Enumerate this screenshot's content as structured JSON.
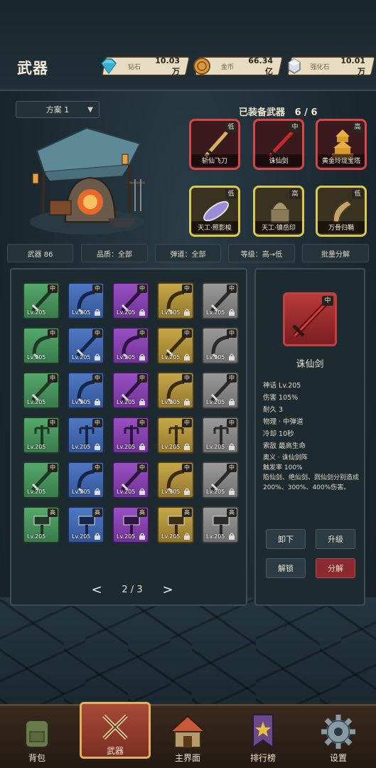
{
  "header": {
    "title": "武器",
    "resources": [
      {
        "label": "钻石",
        "value": "10.03万",
        "icon": "diamond-icon"
      },
      {
        "label": "金币",
        "value": "66.34亿",
        "icon": "coin-icon"
      },
      {
        "label": "强化石",
        "value": "10.01万",
        "icon": "stone-icon"
      }
    ]
  },
  "scheme": {
    "label": "方案 1"
  },
  "equipped": {
    "title": "已装备武器",
    "count": "6 / 6",
    "slots": [
      {
        "name": "斩仙飞刀",
        "tag": "低",
        "frame": "red"
      },
      {
        "name": "诛仙剑",
        "tag": "中",
        "frame": "red"
      },
      {
        "name": "黄金玲珑宝塔",
        "tag": "高",
        "frame": "red"
      },
      {
        "name": "天工·照影梭",
        "tag": "低",
        "frame": "gold"
      },
      {
        "name": "天工·镇岳印",
        "tag": "高",
        "frame": "gold"
      },
      {
        "name": "万骨归鞘",
        "tag": "低",
        "frame": "gold"
      }
    ]
  },
  "filters": [
    "武器 86",
    "品质：全部",
    "弹道：全部",
    "等级：高→低",
    "批量分解"
  ],
  "inventory": {
    "rows": [
      {
        "tag": "中",
        "cells": [
          "green",
          "blue",
          "purple",
          "yellow",
          "gray"
        ]
      },
      {
        "tag": "中",
        "cells": [
          "green",
          "blue",
          "purple",
          "yellow",
          "gray"
        ]
      },
      {
        "tag": "中",
        "cells": [
          "green",
          "blue",
          "purple",
          "yellow",
          "gray"
        ]
      },
      {
        "tag": "中",
        "cells": [
          "green",
          "blue",
          "purple",
          "yellow",
          "gray"
        ]
      },
      {
        "tag": "中",
        "cells": [
          "green",
          "blue",
          "purple",
          "yellow",
          "gray"
        ]
      },
      {
        "tag": "高",
        "cells": [
          "green",
          "blue",
          "purple",
          "yellow",
          "gray"
        ]
      }
    ],
    "level_label": "Lv.205",
    "page": "2 / 3",
    "prev": "<",
    "next": ">"
  },
  "detail": {
    "tag": "中",
    "name": "诛仙剑",
    "stats": [
      "神话 Lv.205",
      "伤害 105%",
      "耐久 3",
      "物理 · 中弹道",
      "冷却 10秒",
      "索敌 最高生命"
    ],
    "skill_title": "奥义 · 诛仙剑阵",
    "skill_rate": "触发率 100%",
    "skill_desc": "陷仙剑、绝仙剑、戮仙剑分别造成200%、300%、400%伤害。",
    "buttons": {
      "unequip": "卸下",
      "upgrade": "升级",
      "unlock": "解锁",
      "dismantle": "分解"
    }
  },
  "nav": [
    {
      "label": "背包",
      "icon": "backpack-icon",
      "active": false
    },
    {
      "label": "武器",
      "icon": "crossed-swords-icon",
      "active": true
    },
    {
      "label": "主界面",
      "icon": "house-icon",
      "active": false
    },
    {
      "label": "排行榜",
      "icon": "banner-star-icon",
      "active": false
    },
    {
      "label": "设置",
      "icon": "gear-icon",
      "active": false
    }
  ]
}
